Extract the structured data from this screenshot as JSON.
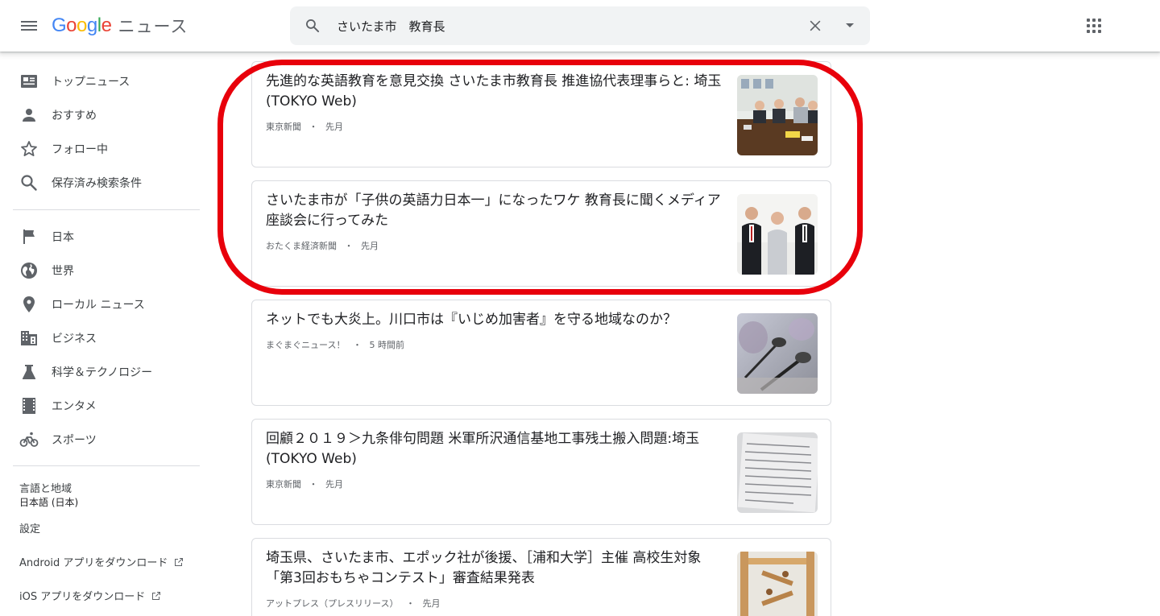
{
  "app": {
    "logo_google": "Google",
    "logo_news": "ニュース"
  },
  "search": {
    "value": "さいたま市　教育長",
    "placeholder": ""
  },
  "sidebar": {
    "primary": [
      {
        "label": "トップニュース",
        "icon": "newspaper-icon"
      },
      {
        "label": "おすすめ",
        "icon": "person-icon"
      },
      {
        "label": "フォロー中",
        "icon": "star-icon"
      },
      {
        "label": "保存済み検索条件",
        "icon": "search-icon"
      }
    ],
    "sections": [
      {
        "label": "日本",
        "icon": "flag-icon"
      },
      {
        "label": "世界",
        "icon": "globe-icon"
      },
      {
        "label": "ローカル ニュース",
        "icon": "location-pin-icon"
      },
      {
        "label": "ビジネス",
        "icon": "building-icon"
      },
      {
        "label": "科学＆テクノロジー",
        "icon": "flask-icon"
      },
      {
        "label": "エンタメ",
        "icon": "film-icon"
      },
      {
        "label": "スポーツ",
        "icon": "bicycle-icon"
      }
    ],
    "language_label": "言語と地域",
    "language_value": "日本語 (日本)",
    "settings_label": "設定",
    "android_label": "Android アプリをダウンロード",
    "ios_label": "iOS アプリをダウンロード"
  },
  "articles": [
    {
      "title": "先進的な英語教育を意見交換 さいたま市教育長 推進協代表理事らと: 埼玉(TOKYO Web)",
      "source": "東京新聞",
      "time": "先月"
    },
    {
      "title": "さいたま市が「子供の英語力日本一」になったワケ 教育長に聞くメディア座談会に行ってみた",
      "source": "おたくま経済新聞",
      "time": "先月"
    },
    {
      "title": "ネットでも大炎上。川口市は『いじめ加害者』を守る地域なのか？",
      "source": "まぐまぐニュース！",
      "time": "5 時間前"
    },
    {
      "title": "回顧２０１９＞九条俳句問題 米軍所沢通信基地工事残土搬入問題:埼玉(TOKYO Web)",
      "source": "東京新聞",
      "time": "先月"
    },
    {
      "title": "埼玉県、さいたま市、エポック社が後援、［浦和大学］主催 高校生対象「第3回おもちゃコンテスト」審査結果発表",
      "source": "アットプレス（プレスリリース）",
      "time": "先月"
    }
  ],
  "meta_separator": "・",
  "colors": {
    "highlight": "#e8000b",
    "icon_gray": "#5f6368",
    "text": "#202124"
  }
}
